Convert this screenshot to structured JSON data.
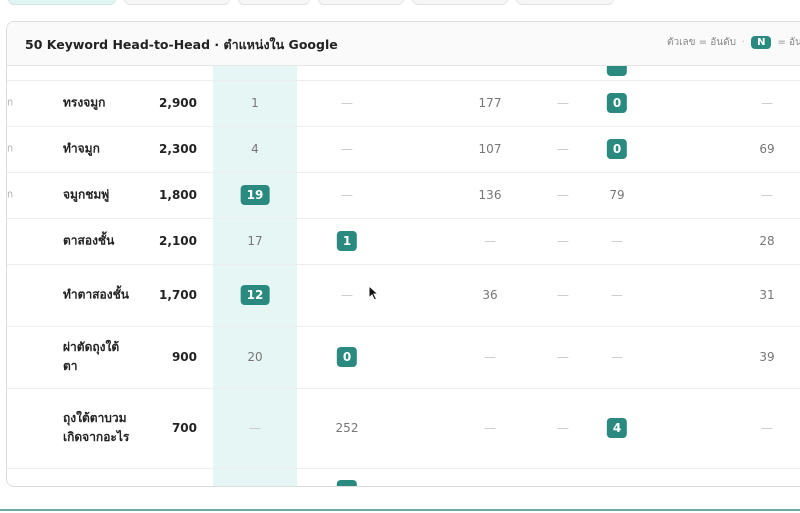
{
  "card": {
    "title": "50 Keyword Head-to-Head · ตำแหน่งใน Google",
    "legend_text": "ตัวเลข = อันดับ",
    "legend_sep": "·",
    "legend_key": "N",
    "legend_key_text": "= อันดับดีสุ"
  },
  "rows": [
    {
      "edge": "ก",
      "keyword": "ทรงจมูก",
      "volume": "2,900",
      "c1": "1",
      "c1_badge": false,
      "c2": "—",
      "c2_badge": false,
      "c3": "177",
      "c4": "—",
      "c5": "0",
      "c5_badge": true,
      "c6": "—"
    },
    {
      "edge": "ก",
      "keyword": "ทำจมูก",
      "volume": "2,300",
      "c1": "4",
      "c1_badge": false,
      "c2": "—",
      "c2_badge": false,
      "c3": "107",
      "c4": "—",
      "c5": "0",
      "c5_badge": true,
      "c6": "69"
    },
    {
      "edge": "ก",
      "keyword": "จมูกชมพู่",
      "volume": "1,800",
      "c1": "19",
      "c1_badge": true,
      "c2": "—",
      "c2_badge": false,
      "c3": "136",
      "c4": "—",
      "c5": "79",
      "c5_badge": false,
      "c6": "—"
    },
    {
      "edge": "",
      "keyword": "ตาสองชั้น",
      "volume": "2,100",
      "c1": "17",
      "c1_badge": false,
      "c2": "1",
      "c2_badge": true,
      "c3": "—",
      "c4": "—",
      "c5": "—",
      "c5_badge": false,
      "c6": "28"
    },
    {
      "edge": "",
      "keyword": "ทำตาสองชั้น",
      "volume": "1,700",
      "c1": "12",
      "c1_badge": true,
      "c2": "—",
      "c2_badge": false,
      "c3": "36",
      "c4": "—",
      "c5": "—",
      "c5_badge": false,
      "c6": "31"
    },
    {
      "edge": "",
      "keyword": "ผ่าตัดถุงใต้ตา",
      "volume": "900",
      "c1": "20",
      "c1_badge": false,
      "c2": "0",
      "c2_badge": true,
      "c3": "—",
      "c4": "—",
      "c5": "—",
      "c5_badge": false,
      "c6": "39"
    },
    {
      "edge": "",
      "keyword": "ถุงใต้ตาบวมเกิดจากอะไร",
      "volume": "700",
      "c1": "—",
      "c1_badge": false,
      "c2": "252",
      "c2_badge": false,
      "c3": "—",
      "c4": "—",
      "c5": "4",
      "c5_badge": true,
      "c6": "—"
    }
  ],
  "colors": {
    "accent": "#2a8a80",
    "highlight": "#e6f6f4"
  },
  "icons": {
    "cursor": "mouse-pointer-icon"
  }
}
